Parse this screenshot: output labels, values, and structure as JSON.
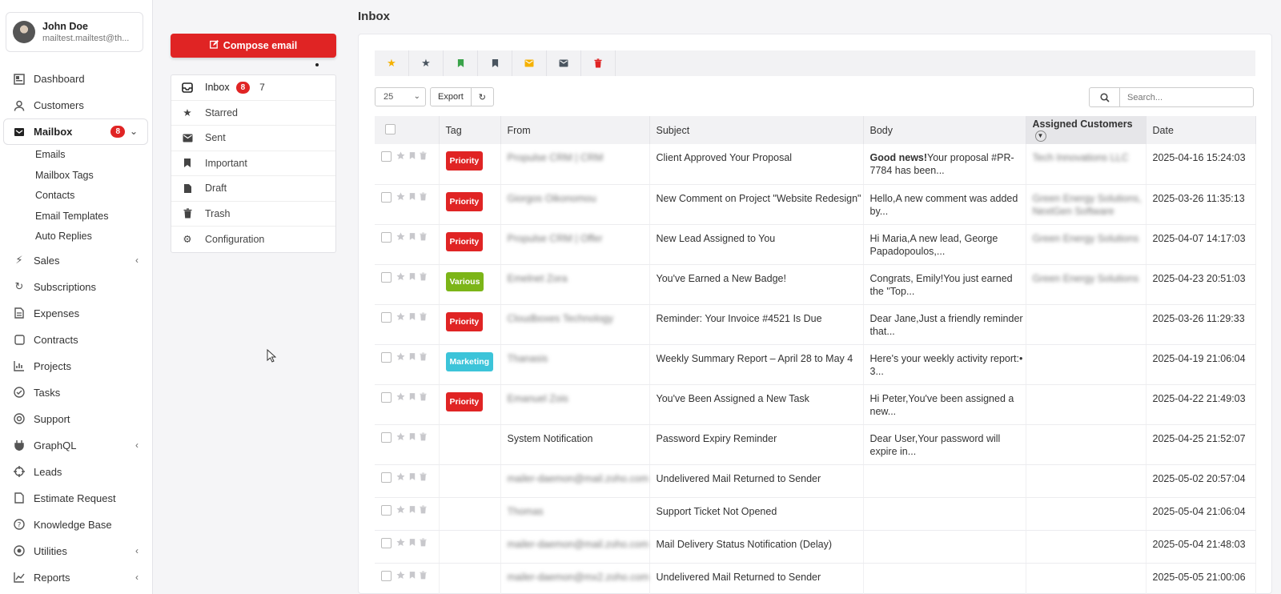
{
  "user": {
    "name": "John Doe",
    "email": "mailtest.mailtest@th..."
  },
  "nav": {
    "items": [
      {
        "label": "Dashboard",
        "icon": "dashboard-icon"
      },
      {
        "label": "Customers",
        "icon": "user-icon"
      },
      {
        "label": "Mailbox",
        "icon": "mailbox-icon",
        "badge": "8"
      }
    ],
    "mailbox_sub": [
      "Emails",
      "Mailbox Tags",
      "Contacts",
      "Email Templates",
      "Auto Replies"
    ],
    "items2": [
      {
        "label": "Sales",
        "icon": "bolt-icon"
      },
      {
        "label": "Subscriptions",
        "icon": "refresh-icon"
      },
      {
        "label": "Expenses",
        "icon": "file-icon"
      },
      {
        "label": "Contracts",
        "icon": "contract-icon"
      },
      {
        "label": "Projects",
        "icon": "chart-icon"
      },
      {
        "label": "Tasks",
        "icon": "check-circle-icon"
      },
      {
        "label": "Support",
        "icon": "lifebuoy-icon"
      },
      {
        "label": "GraphQL",
        "icon": "plug-icon"
      },
      {
        "label": "Leads",
        "icon": "crosshair-icon"
      },
      {
        "label": "Estimate Request",
        "icon": "document-icon"
      },
      {
        "label": "Knowledge Base",
        "icon": "question-icon"
      },
      {
        "label": "Utilities",
        "icon": "dot-circle-icon"
      },
      {
        "label": "Reports",
        "icon": "line-chart-icon"
      }
    ]
  },
  "compose": {
    "label": "Compose email"
  },
  "mailmenu": {
    "inbox": {
      "label": "Inbox",
      "badge": "8",
      "count": "7"
    },
    "starred": "Starred",
    "sent": "Sent",
    "important": "Important",
    "draft": "Draft",
    "trash": "Trash",
    "configuration": "Configuration"
  },
  "page": {
    "title": "Inbox"
  },
  "toolbar": {
    "page_size": "25",
    "export": "Export",
    "search_placeholder": "Search..."
  },
  "colors": {
    "accent": "#e02424",
    "priority": "#e02424",
    "various": "#7cb518",
    "marketing": "#3cc4d9"
  },
  "table": {
    "headers": {
      "tag": "Tag",
      "from": "From",
      "subject": "Subject",
      "body": "Body",
      "assigned": "Assigned Customers",
      "date": "Date"
    },
    "rows": [
      {
        "tag": "Priority",
        "tagcls": "priority",
        "from": "Propulse CRM | CRM",
        "from_blur": true,
        "subject": "Client Approved Your Proposal",
        "body_b1": "Good news!",
        "body_rest": "Your proposal #PR-7784 has been...",
        "assigned": "Tech Innovations LLC",
        "date": "2025-04-16 15:24:03"
      },
      {
        "tag": "Priority",
        "tagcls": "priority",
        "from": "Giorgos Oikonomou",
        "from_blur": true,
        "subject": "New Comment on Project \"Website Redesign\"",
        "body_b1": "",
        "body_rest": "Hello,A new comment was added by...",
        "assigned": "Green Energy Solutions, NextGen Software",
        "date": "2025-03-26 11:35:13"
      },
      {
        "tag": "Priority",
        "tagcls": "priority",
        "from": "Propulse CRM | Offer",
        "from_blur": true,
        "subject": "New Lead Assigned to You",
        "body_b1": "",
        "body_rest": "Hi Maria,A new lead, George Papadopoulos,...",
        "assigned": "Green Energy Solutions",
        "date": "2025-04-07 14:17:03"
      },
      {
        "tag": "Various",
        "tagcls": "various",
        "from": "Emelnet Zora",
        "from_blur": true,
        "subject": "You've Earned a New Badge!",
        "body_b1": "",
        "body_rest": "Congrats, Emily!You just earned the \"Top...",
        "assigned": "Green Energy Solutions",
        "date": "2025-04-23 20:51:03"
      },
      {
        "tag": "Priority",
        "tagcls": "priority",
        "from": "Cloudboxes Technology",
        "from_blur": true,
        "subject": "Reminder: Your Invoice #4521 Is Due",
        "body_b1": "",
        "body_rest": "Dear Jane,Just a friendly reminder that...",
        "assigned": "",
        "date": "2025-03-26 11:29:33"
      },
      {
        "tag": "Marketing",
        "tagcls": "marketing",
        "from": "Thanasis",
        "from_blur": true,
        "subject": "Weekly Summary Report – April 28 to May 4",
        "body_b1": "",
        "body_rest": "Here's your weekly activity report:• 3...",
        "assigned": "",
        "date": "2025-04-19 21:06:04"
      },
      {
        "tag": "Priority",
        "tagcls": "priority",
        "from": "Emanuel Zois",
        "from_blur": true,
        "subject": "You've Been Assigned a New Task",
        "body_b1": "",
        "body_rest": "Hi Peter,You've been assigned a new...",
        "assigned": "",
        "date": "2025-04-22 21:49:03"
      },
      {
        "tag": "",
        "tagcls": "",
        "from": "System Notification",
        "from_blur": false,
        "subject": "Password Expiry Reminder",
        "body_b1": "",
        "body_rest": "Dear User,Your password will expire in...",
        "assigned": "",
        "date": "2025-04-25 21:52:07"
      },
      {
        "tag": "",
        "tagcls": "",
        "from": "mailer-daemon@mail.zoho.com",
        "from_blur": true,
        "subject": "Undelivered Mail Returned to Sender",
        "body_b1": "",
        "body_rest": "",
        "assigned": "",
        "date": "2025-05-02 20:57:04"
      },
      {
        "tag": "",
        "tagcls": "",
        "from": "Thomas",
        "from_blur": true,
        "subject": "Support Ticket Not Opened",
        "body_b1": "",
        "body_rest": "",
        "assigned": "",
        "date": "2025-05-04 21:06:04"
      },
      {
        "tag": "",
        "tagcls": "",
        "from": "mailer-daemon@mail.zoho.com",
        "from_blur": true,
        "subject": "Mail Delivery Status Notification (Delay)",
        "body_b1": "",
        "body_rest": "",
        "assigned": "",
        "date": "2025-05-04 21:48:03"
      },
      {
        "tag": "",
        "tagcls": "",
        "from": "mailer-daemon@mx2.zoho.com",
        "from_blur": true,
        "subject": "Undelivered Mail Returned to Sender",
        "body_b1": "",
        "body_rest": "",
        "assigned": "",
        "date": "2025-05-05 21:00:06"
      }
    ]
  }
}
